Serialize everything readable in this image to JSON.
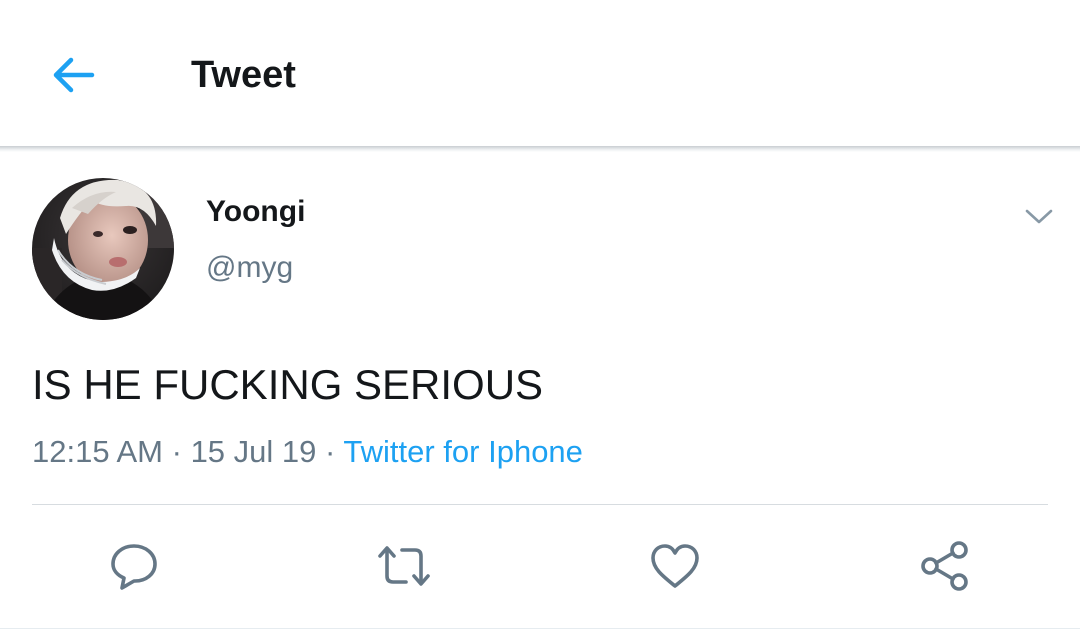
{
  "header": {
    "title": "Tweet",
    "back_icon": "arrow-left-icon",
    "accent_color": "#1da1f2"
  },
  "tweet": {
    "author": {
      "name": "Yoongi",
      "handle": "@myg",
      "avatar": "profile-photo"
    },
    "menu_icon": "chevron-down-icon",
    "text": "IS HE FUCKING SERIOUS",
    "time": "12:15 AM",
    "date": "15 Jul 19",
    "separator": "·",
    "source": "Twitter for Iphone"
  },
  "actions": [
    {
      "name": "reply",
      "icon": "reply-icon"
    },
    {
      "name": "retweet",
      "icon": "retweet-icon"
    },
    {
      "name": "like",
      "icon": "heart-icon"
    },
    {
      "name": "share",
      "icon": "share-icon"
    }
  ],
  "colors": {
    "text_primary": "#14171a",
    "text_secondary": "#657786",
    "link": "#1da1f2",
    "icon_gray": "#657786"
  }
}
